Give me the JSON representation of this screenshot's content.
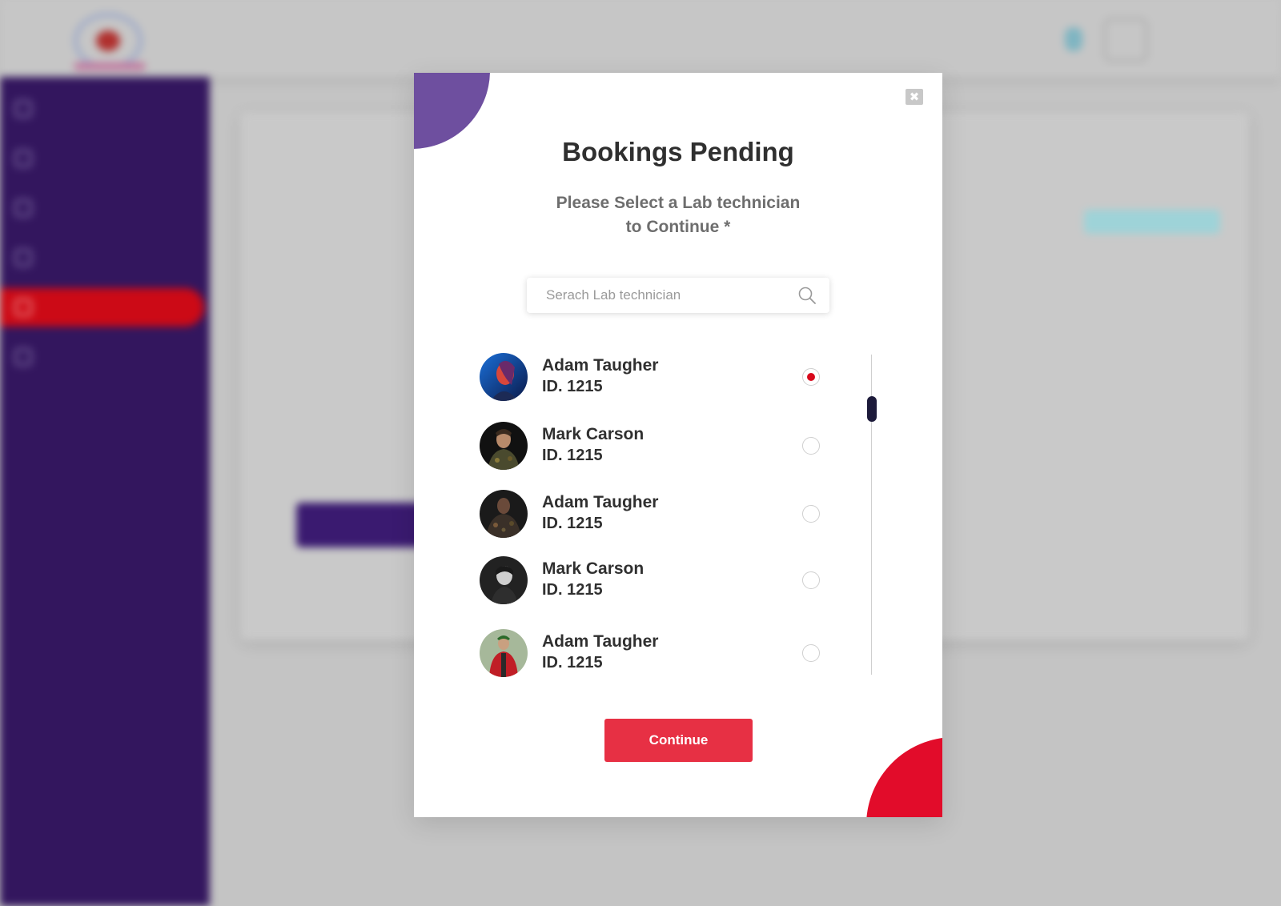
{
  "modal": {
    "close_symbol": "✖",
    "title": "Bookings Pending",
    "subtitle_line1": "Please Select a Lab technician",
    "subtitle_line2": "to Continue *",
    "search": {
      "placeholder": "Serach Lab technician",
      "value": "",
      "icon": "search-icon"
    },
    "technicians": [
      {
        "name": "Adam Taugher",
        "id_label": "ID. 1215",
        "selected": true
      },
      {
        "name": "Mark Carson",
        "id_label": "ID. 1215",
        "selected": false
      },
      {
        "name": "Adam Taugher",
        "id_label": "ID. 1215",
        "selected": false
      },
      {
        "name": "Mark Carson",
        "id_label": "ID. 1215",
        "selected": false
      },
      {
        "name": "Adam Taugher",
        "id_label": "ID. 1215",
        "selected": false
      }
    ],
    "continue_label": "Continue"
  },
  "colors": {
    "accent_red": "#e73044",
    "radio_selected": "#d8091c",
    "blob_purple": "#6e4f9f",
    "blob_red": "#e20c2a",
    "sidebar_purple": "#33165e"
  }
}
